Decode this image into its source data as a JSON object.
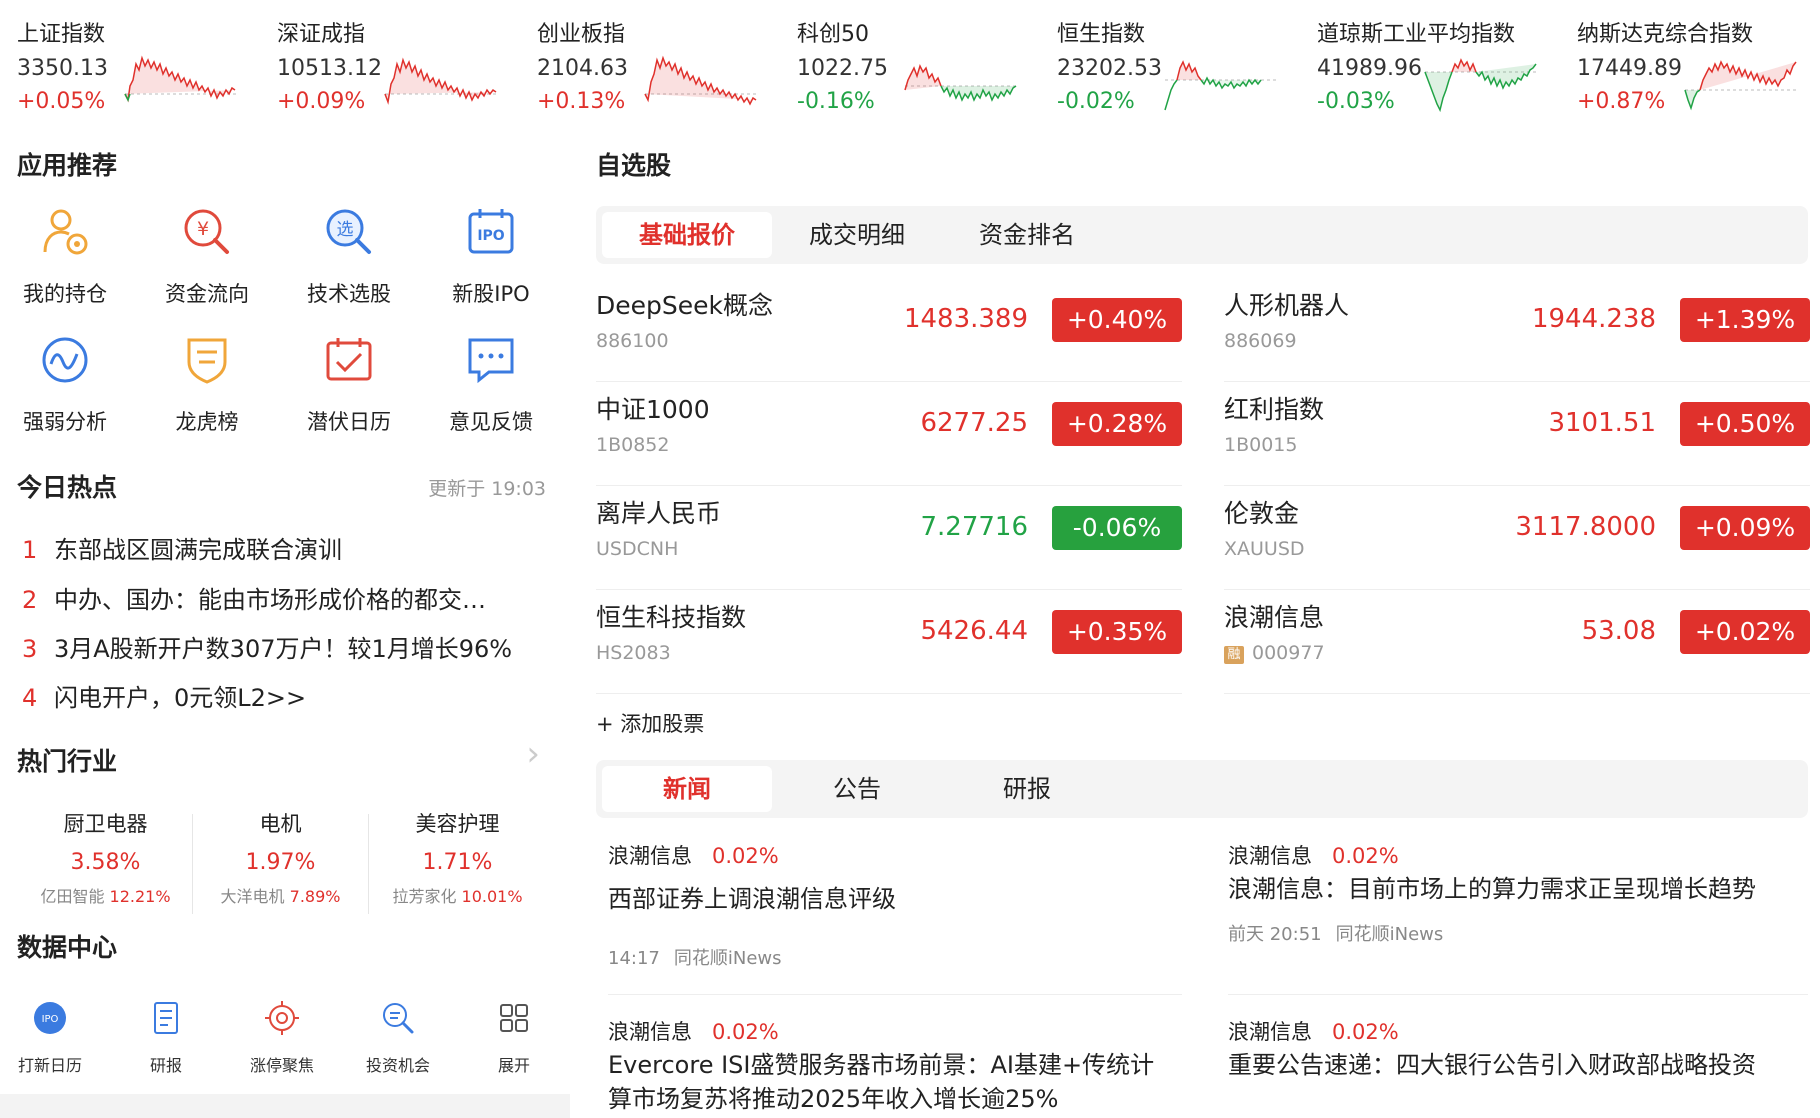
{
  "indices": [
    {
      "name": "上证指数",
      "value": "3350.13",
      "change": "+0.05%",
      "dir": "up"
    },
    {
      "name": "深证成指",
      "value": "10513.12",
      "change": "+0.09%",
      "dir": "up"
    },
    {
      "name": "创业板指",
      "value": "2104.63",
      "change": "+0.13%",
      "dir": "up"
    },
    {
      "name": "科创50",
      "value": "1022.75",
      "change": "-0.16%",
      "dir": "down"
    },
    {
      "name": "恒生指数",
      "value": "23202.53",
      "change": "-0.02%",
      "dir": "down"
    },
    {
      "name": "道琼斯工业平均指数",
      "value": "41989.96",
      "change": "-0.03%",
      "dir": "down"
    },
    {
      "name": "纳斯达克综合指数",
      "value": "17449.89",
      "change": "+0.87%",
      "dir": "up"
    }
  ],
  "apps": {
    "title": "应用推荐",
    "items": [
      {
        "label": "我的持仓",
        "icon": "holdings-icon"
      },
      {
        "label": "资金流向",
        "icon": "money-flow-icon"
      },
      {
        "label": "技术选股",
        "icon": "stock-picker-icon"
      },
      {
        "label": "新股IPO",
        "icon": "ipo-icon"
      },
      {
        "label": "强弱分析",
        "icon": "strength-analysis-icon"
      },
      {
        "label": "龙虎榜",
        "icon": "dragon-tiger-icon"
      },
      {
        "label": "潜伏日历",
        "icon": "calendar-icon"
      },
      {
        "label": "意见反馈",
        "icon": "feedback-icon"
      }
    ]
  },
  "hot": {
    "title": "今日热点",
    "updated": "更新于 19:03",
    "items": [
      {
        "num": "1",
        "text": "东部战区圆满完成联合演训"
      },
      {
        "num": "2",
        "text": "中办、国办：能由市场形成价格的都交…"
      },
      {
        "num": "3",
        "text": "3月A股新开户数307万户！较1月增长96%"
      },
      {
        "num": "4",
        "text": "闪电开户，0元领L2>>"
      }
    ]
  },
  "industries": {
    "title": "热门行业",
    "items": [
      {
        "name": "厨卫电器",
        "pct": "3.58%",
        "stock": "亿田智能",
        "stock_pct": "12.21%"
      },
      {
        "name": "电机",
        "pct": "1.97%",
        "stock": "大洋电机",
        "stock_pct": "7.89%"
      },
      {
        "name": "美容护理",
        "pct": "1.71%",
        "stock": "拉芳家化",
        "stock_pct": "10.01%"
      }
    ]
  },
  "data_center": {
    "title": "数据中心",
    "items": [
      {
        "label": "打新日历",
        "icon": "ipo-calendar-icon"
      },
      {
        "label": "研报",
        "icon": "research-report-icon"
      },
      {
        "label": "涨停聚焦",
        "icon": "limit-up-focus-icon"
      },
      {
        "label": "投资机会",
        "icon": "investment-opportunity-icon"
      },
      {
        "label": "展开",
        "icon": "expand-grid-icon"
      }
    ]
  },
  "watchlist": {
    "title": "自选股",
    "tabs": [
      "基础报价",
      "成交明细",
      "资金排名"
    ],
    "active_tab": 0,
    "stocks": [
      {
        "name": "DeepSeek概念",
        "code": "886100",
        "price": "1483.389",
        "change": "+0.40%",
        "dir": "up",
        "tag": ""
      },
      {
        "name": "人形机器人",
        "code": "886069",
        "price": "1944.238",
        "change": "+1.39%",
        "dir": "up",
        "tag": ""
      },
      {
        "name": "中证1000",
        "code": "1B0852",
        "price": "6277.25",
        "change": "+0.28%",
        "dir": "up",
        "tag": ""
      },
      {
        "name": "红利指数",
        "code": "1B0015",
        "price": "3101.51",
        "change": "+0.50%",
        "dir": "up",
        "tag": ""
      },
      {
        "name": "离岸人民币",
        "code": "USDCNH",
        "price": "7.27716",
        "change": "-0.06%",
        "dir": "down",
        "tag": ""
      },
      {
        "name": "伦敦金",
        "code": "XAUUSD",
        "price": "3117.8000",
        "change": "+0.09%",
        "dir": "up",
        "tag": ""
      },
      {
        "name": "恒生科技指数",
        "code": "HS2083",
        "price": "5426.44",
        "change": "+0.35%",
        "dir": "up",
        "tag": ""
      },
      {
        "name": "浪潮信息",
        "code": "000977",
        "price": "53.08",
        "change": "+0.02%",
        "dir": "up",
        "tag": "融"
      }
    ],
    "add_label": "+ 添加股票"
  },
  "news": {
    "tabs": [
      "新闻",
      "公告",
      "研报"
    ],
    "active_tab": 0,
    "items": [
      {
        "stock": "浪潮信息",
        "pct": "0.02%",
        "title": "西部证券上调浪潮信息评级",
        "time": "14:17",
        "source": "同花顺iNews"
      },
      {
        "stock": "浪潮信息",
        "pct": "0.02%",
        "title": "浪潮信息：目前市场上的算力需求正呈现增长趋势",
        "time": "前天 20:51",
        "source": "同花顺iNews"
      },
      {
        "stock": "浪潮信息",
        "pct": "0.02%",
        "title": "Evercore ISI盛赞服务器市场前景：AI基建+传统计算市场复苏将推动2025年收入增长逾25%",
        "time": "",
        "source": ""
      },
      {
        "stock": "浪潮信息",
        "pct": "0.02%",
        "title": "重要公告速递：四大银行公告引入财政部战略投资",
        "time": "",
        "source": ""
      }
    ]
  },
  "colors": {
    "up": "#e0312c",
    "down": "#21a346",
    "accent": "#e0312c"
  }
}
